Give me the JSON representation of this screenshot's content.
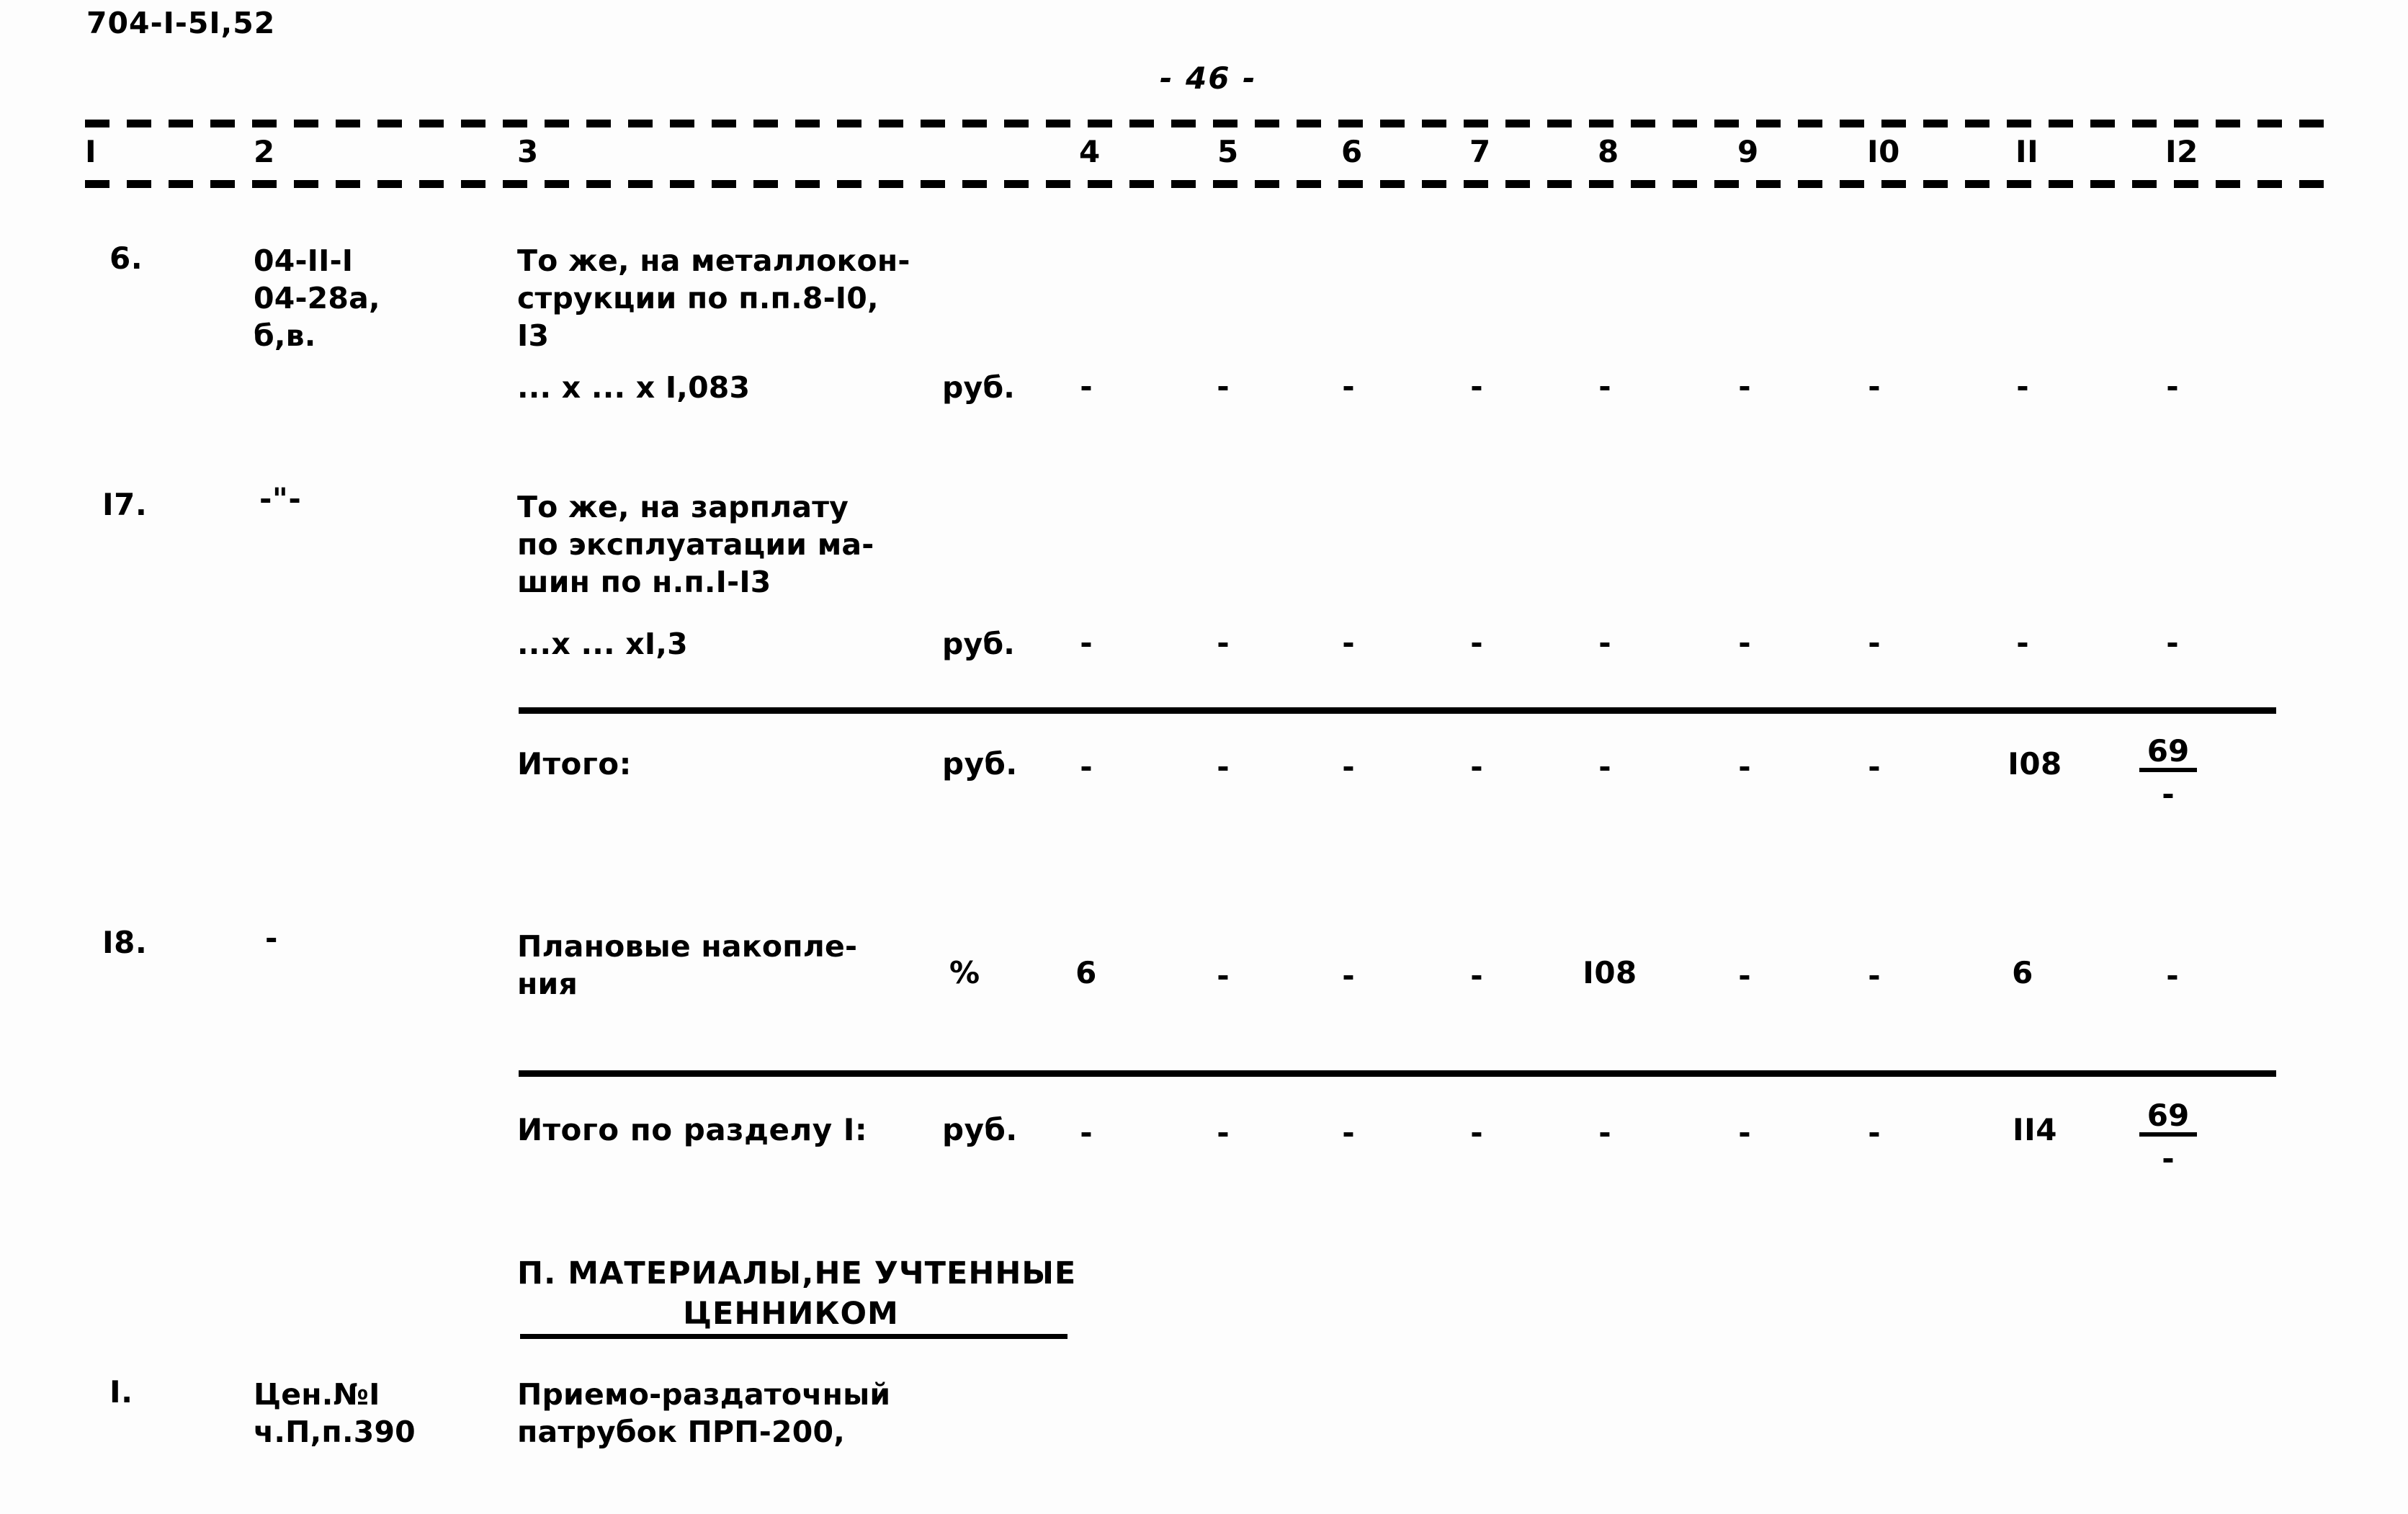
{
  "document": {
    "code": "704-I-5I,52",
    "page_number": "- 46 -"
  },
  "table": {
    "column_headers": [
      "I",
      "2",
      "3",
      "4",
      "5",
      "6",
      "7",
      "8",
      "9",
      "I0",
      "II",
      "I2"
    ],
    "rows": [
      {
        "no": "6.",
        "code_lines": [
          "04-II-I",
          "04-28а,",
          "б,в."
        ],
        "description_lines": [
          "То же, на металлокон-",
          "струкции по п.п.8-I0,",
          "I3"
        ],
        "formula": "... х ... х I,083",
        "unit": "руб.",
        "values": [
          "-",
          "-",
          "-",
          "-",
          "-",
          "-",
          "-",
          "-",
          "-"
        ]
      },
      {
        "no": "I7.",
        "code_lines": [
          "-\"-"
        ],
        "description_lines": [
          "То же, на зарплату",
          "по эксплуатации ма-",
          "шин по н.п.I-I3"
        ],
        "formula": "...х ... хI,3",
        "unit": "руб.",
        "values": [
          "-",
          "-",
          "-",
          "-",
          "-",
          "-",
          "-",
          "-",
          "-"
        ]
      }
    ],
    "totals": [
      {
        "label": "Итого:",
        "unit": "руб.",
        "values": [
          "-",
          "-",
          "-",
          "-",
          "-",
          "-",
          "-"
        ],
        "col11": "I08",
        "col12_numerator": "69",
        "col12_denominator": "-"
      },
      {
        "label": "Итого по разделу I:",
        "unit": "руб.",
        "values": [
          "-",
          "-",
          "-",
          "-",
          "-",
          "-",
          "-"
        ],
        "col11": "II4",
        "col12_numerator": "69",
        "col12_denominator": "-"
      }
    ],
    "plan_row": {
      "no": "I8.",
      "code": "-",
      "description_lines": [
        "Плановые накопле-",
        "ния"
      ],
      "unit": "%",
      "values": [
        "6",
        "-",
        "-",
        "-",
        "I08",
        "-",
        "-",
        "6",
        "-"
      ]
    },
    "section_heading": {
      "line1": "П. МАТЕРИАЛЫ,НЕ УЧТЕННЫЕ",
      "line2": "ЦЕННИКОМ"
    },
    "last_row": {
      "no": "I.",
      "code_lines": [
        "Цен.№I",
        "ч.П,п.390"
      ],
      "description_lines": [
        "Приемо-раздаточный",
        "патрубок ПРП-200,"
      ]
    }
  }
}
